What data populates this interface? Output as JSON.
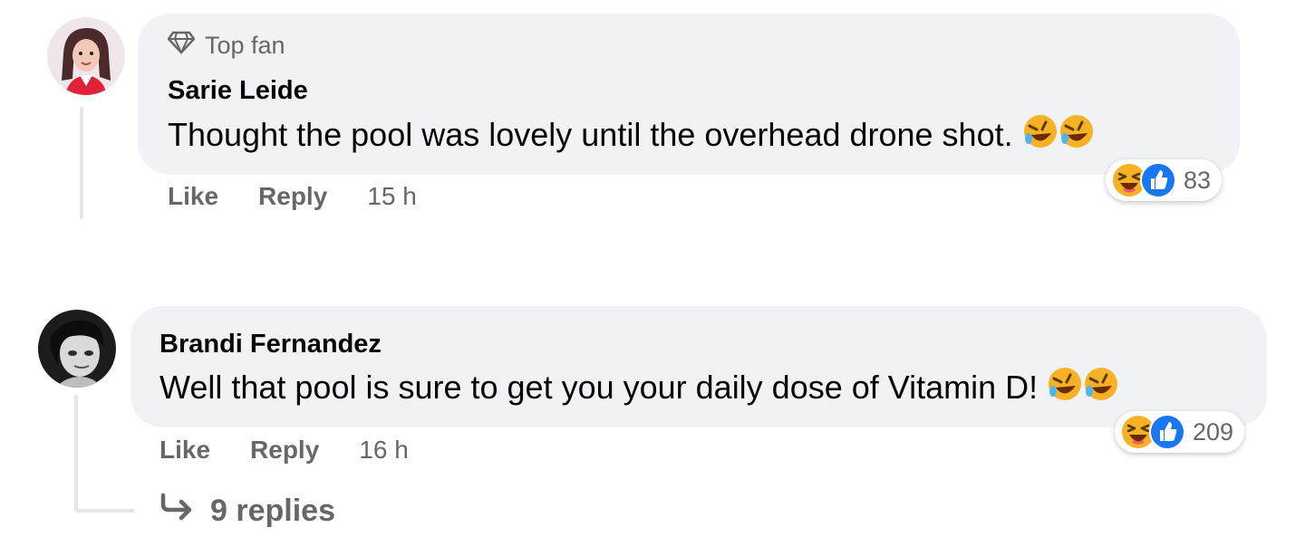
{
  "comments": [
    {
      "badge": "Top fan",
      "author": "Sarie Leide",
      "text": "Thought the pool was lovely until the overhead drone shot.",
      "reaction_count": "83",
      "actions": {
        "like": "Like",
        "reply": "Reply",
        "time": "15 h"
      }
    },
    {
      "author": "Brandi Fernandez",
      "text": "Well that pool is sure to get you your daily dose of Vitamin D!",
      "reaction_count": "209",
      "actions": {
        "like": "Like",
        "reply": "Reply",
        "time": "16 h"
      },
      "replies_label": "9 replies"
    }
  ],
  "icons": {
    "badge": "diamond-icon",
    "inline_emoji": "rolling-on-floor-laughing-emoji",
    "reaction_haha": "haha-reaction-icon",
    "reaction_like": "like-reaction-icon",
    "replies_arrow": "reply-arrow-icon"
  },
  "colors": {
    "bubble": "#f0f2f5",
    "meta_text": "#65676b",
    "like_blue": "#1877f2",
    "haha_yellow": "#f7b125"
  }
}
